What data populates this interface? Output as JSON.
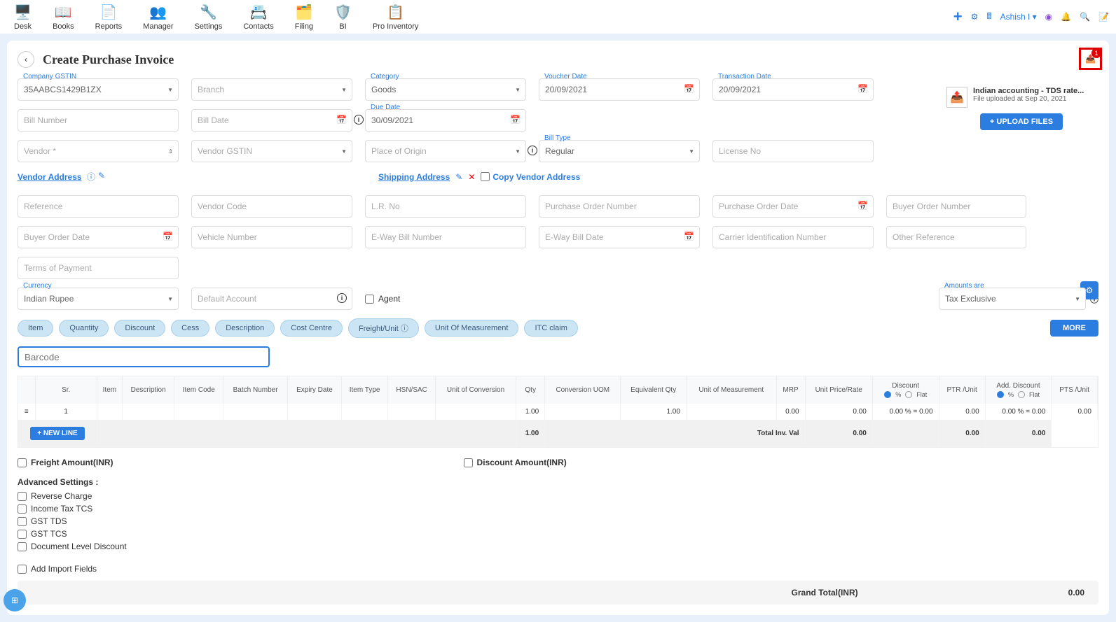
{
  "topnav": [
    {
      "label": "Desk"
    },
    {
      "label": "Books"
    },
    {
      "label": "Reports"
    },
    {
      "label": "Manager"
    },
    {
      "label": "Settings"
    },
    {
      "label": "Contacts"
    },
    {
      "label": "Filing"
    },
    {
      "label": "BI"
    },
    {
      "label": "Pro Inventory"
    }
  ],
  "user": "Ashish I",
  "page_title": "Create Purchase Invoice",
  "attach_count": "1",
  "upload": {
    "title": "Indian accounting - TDS rate...",
    "sub": "File uploaded at Sep 20, 2021",
    "btn": "+ UPLOAD FILES"
  },
  "fields": {
    "company_gstin_label": "Company GSTIN",
    "company_gstin": "35AABCS1429B1ZX",
    "branch_ph": "Branch",
    "category_label": "Category",
    "category": "Goods",
    "voucher_date_label": "Voucher Date",
    "voucher_date": "20/09/2021",
    "transaction_date_label": "Transaction Date",
    "transaction_date": "20/09/2021",
    "bill_number_ph": "Bill Number",
    "bill_date_ph": "Bill Date",
    "due_date_label": "Due Date",
    "due_date": "30/09/2021",
    "vendor_ph": "Vendor *",
    "vendor_gstin_ph": "Vendor GSTIN",
    "place_origin_ph": "Place of Origin",
    "bill_type_label": "Bill Type",
    "bill_type": "Regular",
    "license_ph": "License No",
    "reference_ph": "Reference",
    "vendor_code_ph": "Vendor Code",
    "lr_no_ph": "L.R. No",
    "po_number_ph": "Purchase Order Number",
    "po_date_ph": "Purchase Order Date",
    "buyer_order_no_ph": "Buyer Order Number",
    "buyer_order_date_ph": "Buyer Order Date",
    "vehicle_number_ph": "Vehicle Number",
    "eway_bill_no_ph": "E-Way Bill Number",
    "eway_bill_date_ph": "E-Way Bill Date",
    "carrier_id_ph": "Carrier Identification Number",
    "other_ref_ph": "Other Reference",
    "terms_ph": "Terms of Payment",
    "currency_label": "Currency",
    "currency": "Indian Rupee",
    "default_account_ph": "Default Account",
    "agent_label": "Agent",
    "amounts_label": "Amounts are",
    "amounts": "Tax Exclusive"
  },
  "addr": {
    "vendor": "Vendor Address",
    "shipping": "Shipping Address",
    "copy": "Copy Vendor Address"
  },
  "pills": [
    "Item",
    "Quantity",
    "Discount",
    "Cess",
    "Description",
    "Cost Centre",
    "Freight/Unit",
    "Unit Of Measurement",
    "ITC claim"
  ],
  "more_btn": "MORE",
  "barcode_ph": "Barcode",
  "table": {
    "headers": [
      "Sr.",
      "Item",
      "Description",
      "Item Code",
      "Batch Number",
      "Expiry Date",
      "Item Type",
      "HSN/SAC",
      "Unit of Conversion",
      "Qty",
      "Conversion UOM",
      "Equivalent Qty",
      "Unit of Measurement",
      "MRP",
      "Unit Price/Rate",
      "Discount",
      "PTR /Unit",
      "Add. Discount",
      "PTS /Unit"
    ],
    "disc_pct": "%",
    "disc_flat": "Flat",
    "row": {
      "sr": "1",
      "qty": "1.00",
      "eq_qty": "1.00",
      "mrp": "0.00",
      "price": "0.00",
      "disc": "0.00 % = 0.00",
      "ptr": "0.00",
      "add_disc": "0.00 % = 0.00",
      "pts": "0.00"
    },
    "new_line": "+ NEW LINE",
    "total_row": {
      "qty": "1.00",
      "label": "Total Inv. Val",
      "v1": "0.00",
      "v2": "0.00",
      "v3": "0.00"
    }
  },
  "footer": {
    "freight": "Freight Amount(INR)",
    "discount": "Discount Amount(INR)",
    "adv": "Advanced Settings :",
    "reverse": "Reverse Charge",
    "income_tcs": "Income Tax TCS",
    "gst_tds": "GST TDS",
    "gst_tcs": "GST TCS",
    "doc_disc": "Document Level Discount",
    "add_import": "Add Import Fields"
  },
  "grand_total": {
    "label": "Grand Total(INR)",
    "value": "0.00"
  }
}
